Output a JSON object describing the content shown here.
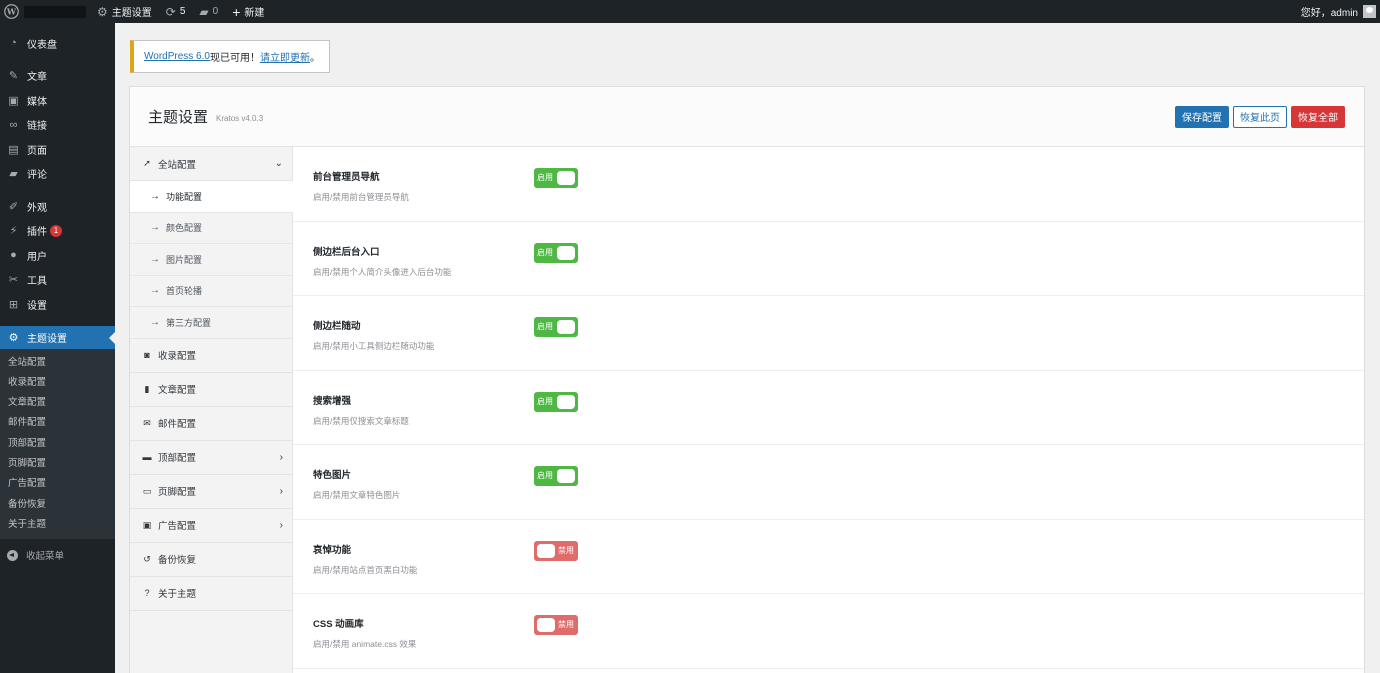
{
  "admin_bar": {
    "site_name": "主题设置",
    "updates_count": "5",
    "comments_count": "0",
    "new_label": "新建",
    "greeting": "您好，admin"
  },
  "sidebar": {
    "items": [
      {
        "label": "仪表盘",
        "icon": "dashboard-icon"
      },
      {
        "label": "文章",
        "icon": "pin-icon"
      },
      {
        "label": "媒体",
        "icon": "media-icon"
      },
      {
        "label": "链接",
        "icon": "link-icon"
      },
      {
        "label": "页面",
        "icon": "page-icon"
      },
      {
        "label": "评论",
        "icon": "comment-icon"
      },
      {
        "label": "外观",
        "icon": "brush-icon"
      },
      {
        "label": "插件",
        "icon": "plugin-icon",
        "badge": "1"
      },
      {
        "label": "用户",
        "icon": "user-icon"
      },
      {
        "label": "工具",
        "icon": "wrench-icon"
      },
      {
        "label": "设置",
        "icon": "settings-icon"
      }
    ],
    "current": {
      "label": "主题设置",
      "icon": "gear-icon"
    },
    "submenu": [
      "全站配置",
      "收录配置",
      "文章配置",
      "邮件配置",
      "顶部配置",
      "页脚配置",
      "广告配置",
      "备份恢复",
      "关于主题"
    ],
    "collapse_label": "收起菜单"
  },
  "notice": {
    "link1": "WordPress 6.0",
    "text": "现已可用！",
    "link2": "请立即更新",
    "end": "。"
  },
  "panel": {
    "title": "主题设置",
    "version": "Kratos v4.0.3",
    "buttons": {
      "save": "保存配置",
      "reset_page": "恢复此页",
      "reset_all": "恢复全部"
    }
  },
  "nav": {
    "top": {
      "label": "全站配置",
      "icon": "rocket-icon"
    },
    "subs": [
      "功能配置",
      "颜色配置",
      "图片配置",
      "首页轮播",
      "第三方配置"
    ],
    "items": [
      {
        "label": "收录配置",
        "icon": "camera-icon",
        "chevron": false
      },
      {
        "label": "文章配置",
        "icon": "file-icon",
        "chevron": false
      },
      {
        "label": "邮件配置",
        "icon": "envelope-icon",
        "chevron": false
      },
      {
        "label": "顶部配置",
        "icon": "header-icon",
        "chevron": true
      },
      {
        "label": "页脚配置",
        "icon": "footer-icon",
        "chevron": true
      },
      {
        "label": "广告配置",
        "icon": "ad-icon",
        "chevron": true
      },
      {
        "label": "备份恢复",
        "icon": "undo-icon",
        "chevron": false
      },
      {
        "label": "关于主题",
        "icon": "question-icon",
        "chevron": false
      }
    ]
  },
  "fields": [
    {
      "title": "前台管理员导航",
      "desc": "启用/禁用前台管理员导航",
      "state": "on",
      "switch_label": "启用"
    },
    {
      "title": "侧边栏后台入口",
      "desc": "启用/禁用个人简介头像进入后台功能",
      "state": "on",
      "switch_label": "启用"
    },
    {
      "title": "侧边栏随动",
      "desc": "启用/禁用小工具侧边栏随动功能",
      "state": "on",
      "switch_label": "启用"
    },
    {
      "title": "搜索增强",
      "desc": "启用/禁用仅搜索文章标题",
      "state": "on",
      "switch_label": "启用"
    },
    {
      "title": "特色图片",
      "desc": "启用/禁用文章特色图片",
      "state": "on",
      "switch_label": "启用"
    },
    {
      "title": "哀悼功能",
      "desc": "启用/禁用站点首页黑白功能",
      "state": "off",
      "switch_label": "禁用"
    },
    {
      "title": "CSS 动画库",
      "desc": "启用/禁用 animate.css 效果",
      "state": "off",
      "switch_label": "禁用"
    }
  ],
  "colors": {
    "accent": "#2271b1",
    "on": "#4fb845",
    "off": "#e06b6b",
    "danger": "#d63638"
  }
}
